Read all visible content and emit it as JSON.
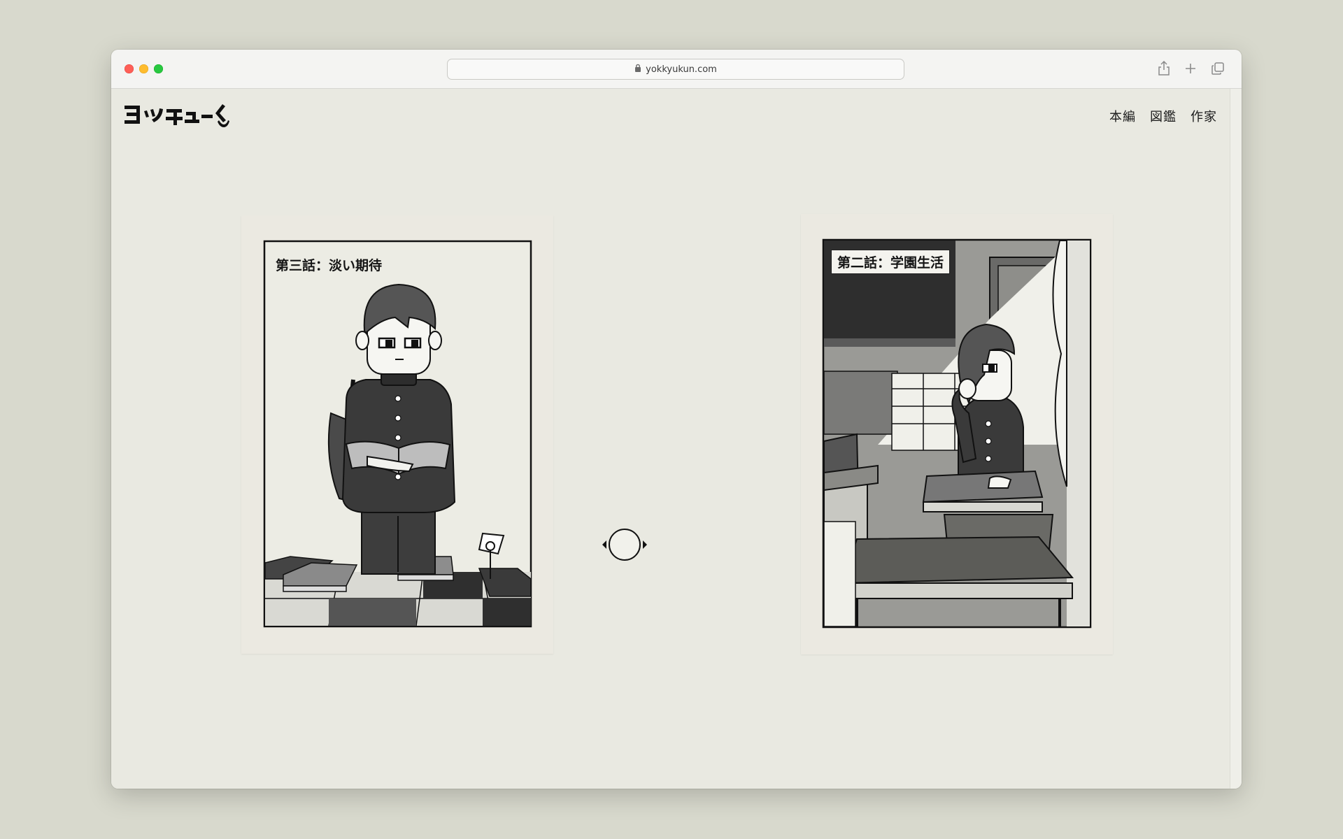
{
  "browser": {
    "url": "yokkyukun.com",
    "icons": [
      "lock-icon",
      "share-icon",
      "new-tab-icon",
      "tab-overview-icon"
    ]
  },
  "site": {
    "logo_text": "ヨッキューくん",
    "nav": [
      {
        "label": "本編"
      },
      {
        "label": "図鑑"
      },
      {
        "label": "作家"
      }
    ]
  },
  "cards": [
    {
      "title": "第三話：淡い期待"
    },
    {
      "title": "第二話：学園生活"
    }
  ],
  "controls": {
    "dial_icon": "circle-with-left-right-arrows-icon"
  },
  "colors": {
    "page_bg": "#e9e9e1",
    "ink": "#1a1a1a",
    "paper": "#ebe9e1"
  }
}
